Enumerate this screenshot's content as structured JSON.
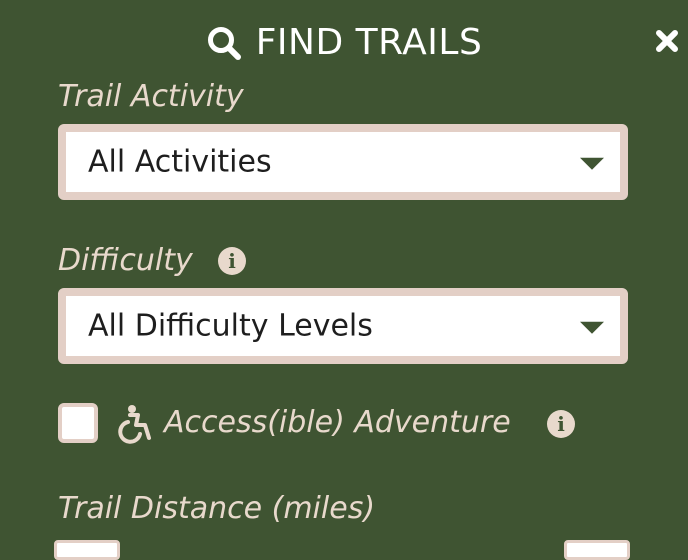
{
  "header": {
    "title": "FIND TRAILS"
  },
  "filters": {
    "activity": {
      "label": "Trail Activity",
      "selected": "All Activities"
    },
    "difficulty": {
      "label": "Difficulty",
      "selected": "All Difficulty Levels"
    },
    "accessible": {
      "label": "Access(ible) Adventure",
      "checked": false
    },
    "distance": {
      "label": "Trail Distance (miles)"
    }
  },
  "icons": {
    "search": "search-icon",
    "close": "close-icon",
    "info": "info-icon",
    "accessibility": "wheelchair-icon",
    "dropdown": "chevron-down-icon"
  },
  "colors": {
    "background": "#3f5432",
    "label": "#e8d9cc",
    "field_border": "#e3cfc6",
    "text_dark": "#1e1e1e"
  }
}
